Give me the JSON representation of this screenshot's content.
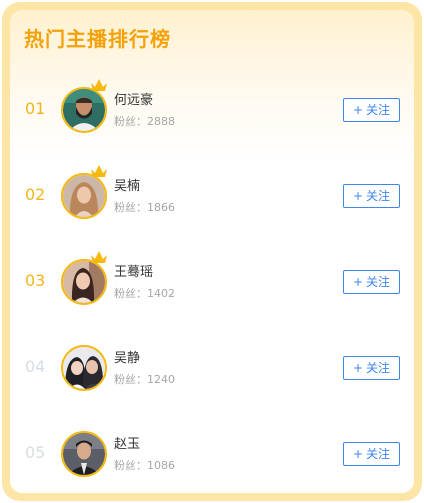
{
  "title": "热门主播排行榜",
  "follow_plus": "+",
  "colors": {
    "title": "#f5a10a",
    "rank_top": "#f2b51f",
    "rank_other": "#d6dde4",
    "follow_accent": "#3f86e8",
    "frame": "#fde5a6"
  },
  "anchors": [
    {
      "rank": "01",
      "name": "何远豪",
      "fans": "粉丝：2888",
      "follow_label": "关注",
      "crown": true,
      "avatar_icon": "male-avatar-bearded"
    },
    {
      "rank": "02",
      "name": "吴楠",
      "fans": "粉丝：1866",
      "follow_label": "关注",
      "crown": true,
      "avatar_icon": "female-avatar-blonde"
    },
    {
      "rank": "03",
      "name": "王蓦瑶",
      "fans": "粉丝：1402",
      "follow_label": "关注",
      "crown": true,
      "avatar_icon": "female-avatar-dark-hair"
    },
    {
      "rank": "04",
      "name": "吴静",
      "fans": "粉丝：1240",
      "follow_label": "关注",
      "crown": false,
      "avatar_icon": "couple-avatar"
    },
    {
      "rank": "05",
      "name": "赵玉",
      "fans": "粉丝：1086",
      "follow_label": "关注",
      "crown": false,
      "avatar_icon": "male-avatar-suit"
    }
  ]
}
